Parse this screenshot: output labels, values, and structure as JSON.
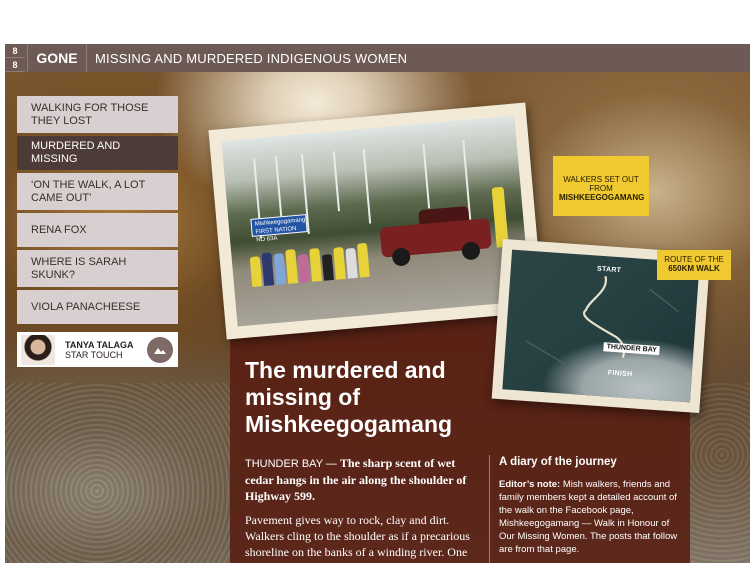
{
  "header": {
    "page_numbers": [
      "8",
      "8"
    ],
    "section": "GONE",
    "title": "MISSING AND MURDERED INDIGENOUS WOMEN"
  },
  "nav": {
    "items": [
      {
        "label": "WALKING FOR THOSE THEY LOST",
        "active": false
      },
      {
        "label": "MURDERED AND MISSING",
        "active": true
      },
      {
        "label": "‘ON THE WALK, A LOT CAME OUT’",
        "active": false
      },
      {
        "label": "RENA FOX",
        "active": false
      },
      {
        "label": "WHERE IS SARAH SKUNK?",
        "active": false
      },
      {
        "label": "VIOLA PANACHEESE",
        "active": false
      }
    ]
  },
  "author": {
    "name": "TANYA TALAGA",
    "publication": "STAR TOUCH"
  },
  "photo": {
    "sign_text": "Mishkeegogamang FIRST NATION NO 63A"
  },
  "callouts": {
    "walkers_line1": "WALKERS SET OUT",
    "walkers_line2": "FROM",
    "walkers_place": "MISHKEEGOGAMANG",
    "route_line1": "ROUTE OF THE",
    "route_dist": "650KM WALK"
  },
  "map": {
    "start": "START",
    "city": "THUNDER BAY",
    "finish": "FINISH"
  },
  "article": {
    "headline": "The murdered and missing of Mishkeegogamang",
    "dateline": "THUNDER BAY —",
    "lead_bold": "The sharp scent of wet cedar hangs in the air along the shoulder of Highway 599.",
    "para2": "Pavement gives way to rock, clay and dirt. Walkers cling to the shoulder as if a precarious shoreline on the banks of a winding river. One wrong step can mean a"
  },
  "sidebar": {
    "title": "A diary of the journey",
    "note_label": "Editor’s note:",
    "note_text": "Mish walkers, friends and family members kept a detailed account of the walk on the Facebook page, Mishkeegogamang — Walk in Honour of Our Missing Women. The posts that follow are from that page."
  },
  "colors": {
    "header_bg": "#6d5a55",
    "nav_bg": "#d8cfd0",
    "nav_active": "#4d3b37",
    "callout": "#f0c930",
    "panel": "#581e12"
  }
}
